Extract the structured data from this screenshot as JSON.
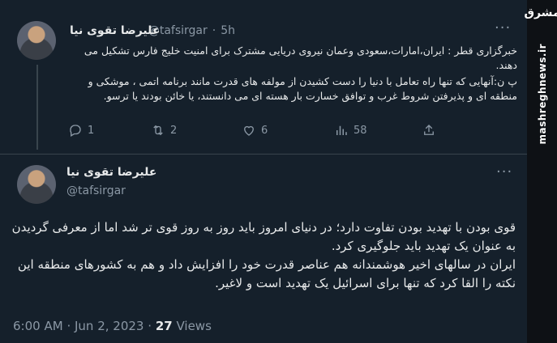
{
  "tweet1": {
    "author_name": "علیرضا تقوی نیا",
    "handle": "@tafsirgar",
    "separator": "·",
    "time_ago": "5h",
    "text_lines": [
      "خبرگزاری قطر : ایران،امارات،سعودی وعمان نیروی دریایی مشترک برای امنیت خلیج فارس تشکیل می دهند.",
      "پ ن:آنهایی که تنها راه تعامل با دنیا را دست کشیدن از مولفه های قدرت مانند برنامه اتمی ، موشکی و منطقه ای و پذیرفتن شروط غرب و توافق خسارت بار هسته ای می دانستند، یا خائن بودند یا ترسو."
    ],
    "actions": {
      "reply_count": "1",
      "retweet_count": "2",
      "like_count": "6",
      "views_count": "58"
    }
  },
  "tweet2": {
    "author_name": "علیرضا تقوی نیا",
    "handle": "@tafsirgar",
    "text_lines": [
      "قوی بودن با تهدید بودن تفاوت دارد؛ در دنیای امروز باید روز به روز قوی تر شد اما از معرفی گردیدن به عنوان یک تهدید باید جلوگیری کرد.",
      "ایران در سالهای اخیر هوشمندانه هم عناصر قدرت خود را افزایش داد و هم به کشورهای منطقه این نکته را القا کرد که تنها برای اسرائیل یک تهدید است و لاغیر."
    ],
    "time": "6:00 AM",
    "separator": "·",
    "date": "Jun 2, 2023",
    "views_count": "27",
    "views_label": "Views"
  },
  "watermark": {
    "logo": "مشرق",
    "url": "mashreghnews.ir"
  },
  "colors": {
    "background": "#15202b",
    "text": "#e7e9ea",
    "secondary": "#8b98a5",
    "divider": "#38444d"
  },
  "icons": [
    "more-icon",
    "reply-icon",
    "retweet-icon",
    "like-icon",
    "views-icon",
    "share-icon"
  ]
}
